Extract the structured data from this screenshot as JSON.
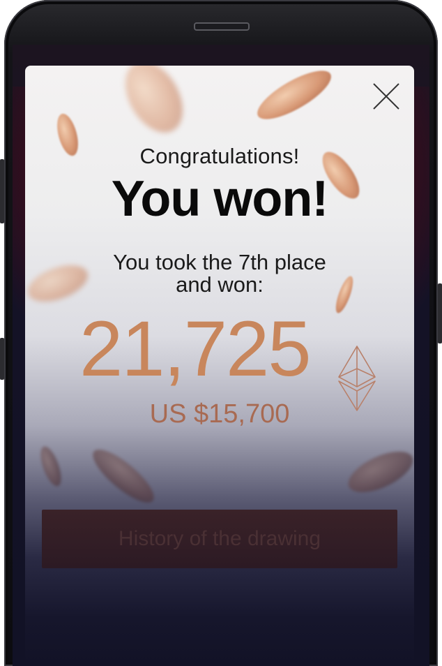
{
  "modal": {
    "congrats": "Congratulations!",
    "headline": "You won!",
    "place_line1": "You took the 7th place",
    "place_line2": "and won:",
    "amount": "21,725",
    "currency_icon": "ethereum-icon",
    "usd_value": "US $15,700",
    "history_button": "History of the drawing",
    "close_icon": "close-icon"
  },
  "colors": {
    "accent": "#c8865c",
    "usd": "#a86a52",
    "headline": "#0a0a0a"
  }
}
